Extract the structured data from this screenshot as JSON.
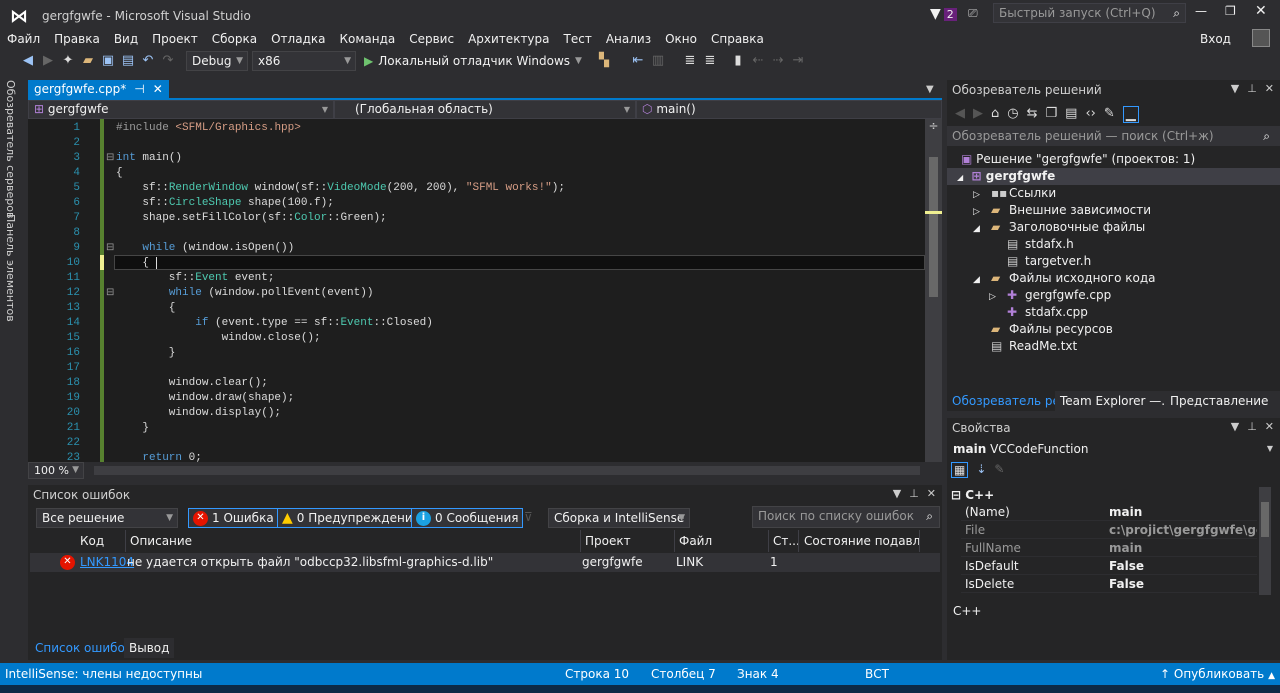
{
  "window": {
    "title": "gergfgwfe - Microsoft Visual Studio",
    "notification_count": "2",
    "quick_launch_placeholder": "Быстрый запуск (Ctrl+Q)",
    "sign_in": "Вход"
  },
  "menu": [
    "Файл",
    "Правка",
    "Вид",
    "Проект",
    "Сборка",
    "Отладка",
    "Команда",
    "Сервис",
    "Архитектура",
    "Тест",
    "Анализ",
    "Окно",
    "Справка"
  ],
  "toolbar": {
    "config": "Debug",
    "platform": "x86",
    "run_label": "Локальный отладчик Windows"
  },
  "side_tabs": [
    "Обозреватель серверов",
    "Панель элементов"
  ],
  "editor": {
    "tab": "gergfgwfe.cpp*",
    "nav_project": "gergfgwfe",
    "nav_scope": "(Глобальная область)",
    "nav_member": "main()",
    "zoom": "100 %",
    "lines": [
      [
        [
          "#include ",
          "p"
        ],
        [
          "<SFML/Graphics.hpp>",
          "s"
        ]
      ],
      [],
      [
        [
          "int",
          "k"
        ],
        [
          " main()",
          ""
        ]
      ],
      [
        [
          "{",
          ""
        ]
      ],
      [
        [
          "    sf::",
          ""
        ],
        [
          "RenderWindow",
          "t"
        ],
        [
          " window(sf::",
          ""
        ],
        [
          "VideoMode",
          "t"
        ],
        [
          "(200, 200), ",
          ""
        ],
        [
          "\"SFML works!\"",
          "s"
        ],
        [
          ");",
          ""
        ]
      ],
      [
        [
          "    sf::",
          ""
        ],
        [
          "CircleShape",
          "t"
        ],
        [
          " shape(100.f);",
          ""
        ]
      ],
      [
        [
          "    shape.setFillColor(sf::",
          ""
        ],
        [
          "Color",
          "t"
        ],
        [
          "::Green);",
          ""
        ]
      ],
      [],
      [
        [
          "    ",
          ""
        ],
        [
          "while",
          "k"
        ],
        [
          " (window.isOpen())",
          ""
        ]
      ],
      [
        [
          "    { ",
          ""
        ]
      ],
      [
        [
          "        sf::",
          ""
        ],
        [
          "Event",
          "t"
        ],
        [
          " event;",
          ""
        ]
      ],
      [
        [
          "        ",
          ""
        ],
        [
          "while",
          "k"
        ],
        [
          " (window.pollEvent(event))",
          ""
        ]
      ],
      [
        [
          "        {",
          ""
        ]
      ],
      [
        [
          "            ",
          ""
        ],
        [
          "if",
          "k"
        ],
        [
          " (event.type == sf::",
          ""
        ],
        [
          "Event",
          "t"
        ],
        [
          "::Closed)",
          ""
        ]
      ],
      [
        [
          "                window.close();",
          ""
        ]
      ],
      [
        [
          "        }",
          ""
        ]
      ],
      [],
      [
        [
          "        window.clear();",
          ""
        ]
      ],
      [
        [
          "        window.draw(shape);",
          ""
        ]
      ],
      [
        [
          "        window.display();",
          ""
        ]
      ],
      [
        [
          "    }",
          ""
        ]
      ],
      [],
      [
        [
          "    ",
          ""
        ],
        [
          "return",
          "k"
        ],
        [
          " 0;",
          ""
        ]
      ]
    ]
  },
  "error_list": {
    "title": "Список ошибок",
    "scope": "Все решение",
    "errors_btn": "1 Ошибка",
    "warnings_btn": "0 Предупреждения",
    "messages_btn": "0 Сообщения",
    "source": "Сборка и IntelliSense",
    "search_placeholder": "Поиск по списку ошибок",
    "columns": [
      "Код",
      "Описание",
      "Проект",
      "Файл",
      "Ст...",
      "Состояние подавл..."
    ],
    "rows": [
      {
        "code": "LNK1104",
        "desc": "не удается открыть файл \"odbccp32.libsfml-graphics-d.lib\"",
        "project": "gergfgwfe",
        "file": "LINK",
        "line": "1",
        "state": ""
      }
    ],
    "tabs": [
      "Список ошибок",
      "Вывод"
    ]
  },
  "solution_explorer": {
    "title": "Обозреватель решений",
    "search_placeholder": "Обозреватель решений — поиск (Ctrl+ж)",
    "solution": "Решение \"gergfgwfe\"  (проектов: 1)",
    "project": "gergfgwfe",
    "items": [
      {
        "label": "Ссылки",
        "level": 2
      },
      {
        "label": "Внешние зависимости",
        "level": 2
      },
      {
        "label": "Заголовочные файлы",
        "level": 2
      },
      {
        "label": "stdafx.h",
        "level": 3
      },
      {
        "label": "targetver.h",
        "level": 3
      },
      {
        "label": "Файлы исходного кода",
        "level": 2
      },
      {
        "label": "gergfgwfe.cpp",
        "level": 3
      },
      {
        "label": "stdafx.cpp",
        "level": 3
      },
      {
        "label": "Файлы ресурсов",
        "level": 2
      },
      {
        "label": "ReadMe.txt",
        "level": 2
      }
    ],
    "tabs": [
      "Обозреватель ре...",
      "Team Explorer —...",
      "Представление к..."
    ]
  },
  "properties": {
    "title": "Свойства",
    "object_name": "main",
    "object_type": "VCCodeFunction",
    "category": "C++",
    "rows": [
      {
        "name": "(Name)",
        "value": "main"
      },
      {
        "name": "File",
        "value": "c:\\projict\\gergfgwfe\\gergfg"
      },
      {
        "name": "FullName",
        "value": "main"
      },
      {
        "name": "IsDefault",
        "value": "False"
      },
      {
        "name": "IsDelete",
        "value": "False"
      }
    ],
    "description": "C++"
  },
  "status": {
    "message": "IntelliSense: члены недоступны",
    "line": "Строка 10",
    "col": "Столбец 7",
    "ch": "Знак 4",
    "mode": "ВСТ",
    "publish": "Опубликовать"
  },
  "colors": {
    "accent": "#007acc",
    "error": "#e51400",
    "code_bg": "#1e1e1e"
  }
}
